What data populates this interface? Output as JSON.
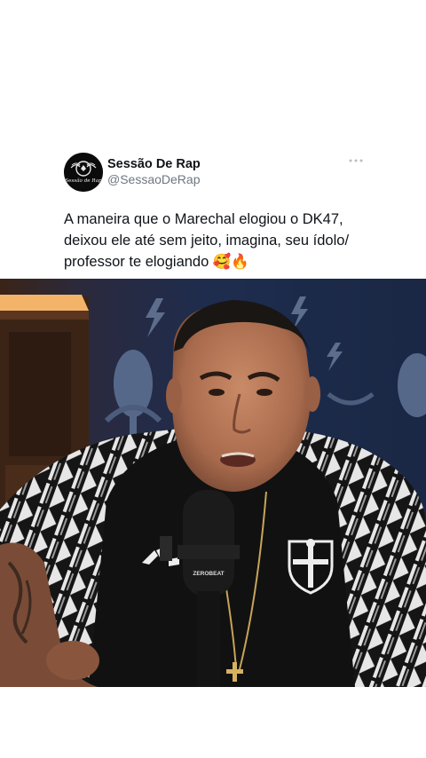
{
  "tweet": {
    "display_name": "Sessão De Rap",
    "handle": "@SessaoDeRap",
    "avatar_text": "Sessão de Rap",
    "text": "A maneira que o Marechal elogiou o DK47,\ndeixou ele até sem jeito, imagina, seu ídolo/\nprofessor te elogiando 🥰🔥"
  },
  "media": {
    "mic_brand": "ZEROBEAT"
  },
  "icons": {
    "more": "more-horizontal-icon"
  }
}
